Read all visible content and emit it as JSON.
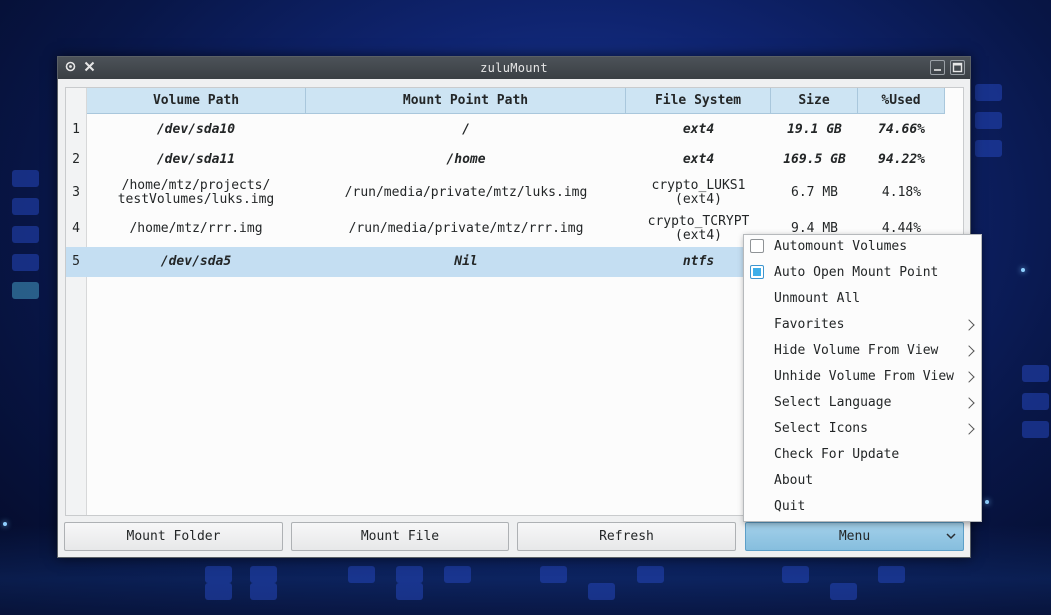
{
  "window": {
    "title": "zuluMount"
  },
  "table": {
    "columns": [
      "Volume Path",
      "Mount Point Path",
      "File System",
      "Size",
      "%Used"
    ],
    "rows": [
      {
        "num": "1",
        "volume": "/dev/sda10",
        "mount": "/",
        "fs": "ext4",
        "size": "19.1 GB",
        "used": "74.66%"
      },
      {
        "num": "2",
        "volume": "/dev/sda11",
        "mount": "/home",
        "fs": "ext4",
        "size": "169.5 GB",
        "used": "94.22%"
      },
      {
        "num": "3",
        "volume": "/home/mtz/projects/\ntestVolumes/luks.img",
        "mount": "/run/media/private/mtz/luks.img",
        "fs": "crypto_LUKS1\n(ext4)",
        "size": "6.7 MB",
        "used": "4.18%"
      },
      {
        "num": "4",
        "volume": "/home/mtz/rrr.img",
        "mount": "/run/media/private/mtz/rrr.img",
        "fs": "crypto_TCRYPT\n(ext4)",
        "size": "9.4 MB",
        "used": "4.44%"
      },
      {
        "num": "5",
        "volume": "/dev/sda5",
        "mount": "Nil",
        "fs": "ntfs",
        "size": "",
        "used": ""
      }
    ]
  },
  "buttons": {
    "mount_folder": "Mount Folder",
    "mount_file": "Mount File",
    "refresh": "Refresh",
    "menu": "Menu"
  },
  "menu": {
    "items": [
      {
        "label": "Automount Volumes",
        "checkbox": true,
        "checked": false
      },
      {
        "label": "Auto Open Mount Point",
        "checkbox": true,
        "checked": true
      },
      {
        "label": "Unmount All"
      },
      {
        "label": "Favorites",
        "submenu": true
      },
      {
        "label": "Hide Volume From View",
        "submenu": true
      },
      {
        "label": "Unhide Volume From View",
        "submenu": true
      },
      {
        "label": "Select Language",
        "submenu": true
      },
      {
        "label": "Select Icons",
        "submenu": true
      },
      {
        "label": "Check For Update"
      },
      {
        "label": "About"
      },
      {
        "label": "Quit"
      }
    ]
  },
  "colors": {
    "accent": "#3daee9",
    "selection": "#c4def2",
    "header": "#cde4f3"
  }
}
